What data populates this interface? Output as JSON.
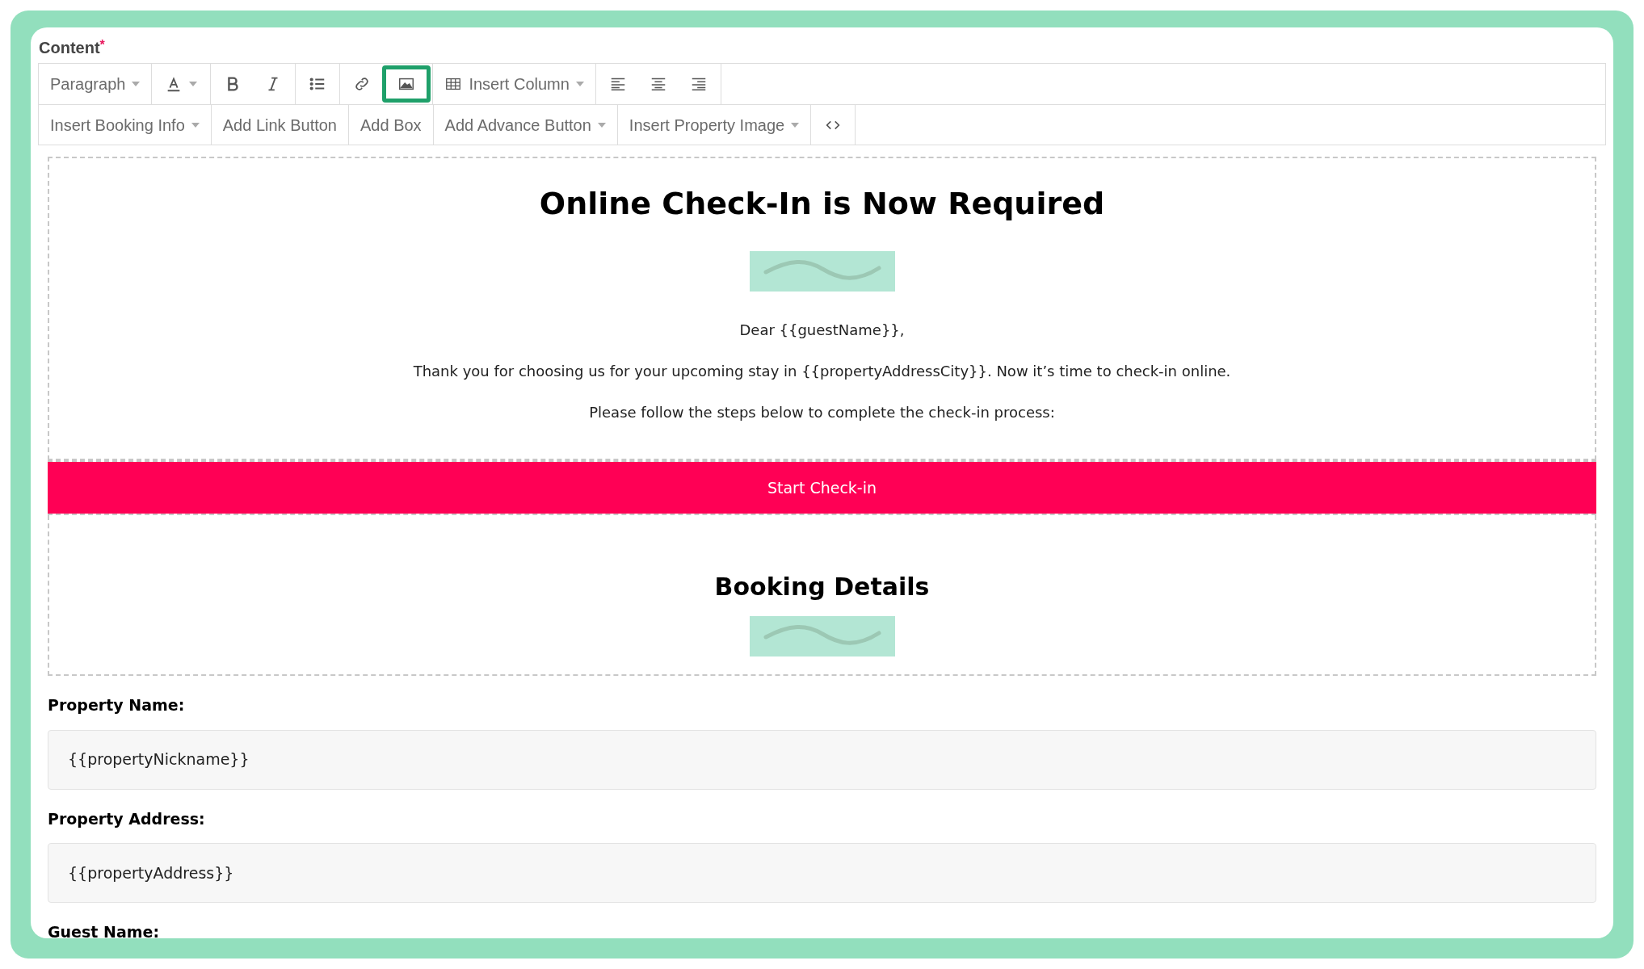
{
  "field_label": {
    "text": "Content",
    "required_mark": "*"
  },
  "toolbar_rows": [
    [
      [
        {
          "kind": "dropdown",
          "label": "Paragraph",
          "highlighted": false
        }
      ],
      [
        {
          "kind": "icon",
          "highlighted": false
        }
      ],
      [
        {
          "kind": "icon",
          "highlighted": false
        },
        {
          "kind": "icon",
          "highlighted": false
        }
      ],
      [
        {
          "kind": "icon",
          "highlighted": false
        }
      ],
      [
        {
          "kind": "icon",
          "highlighted": false
        },
        {
          "kind": "icon",
          "highlighted": true
        }
      ],
      [
        {
          "kind": "dropdown",
          "label": "Insert Column",
          "highlighted": false
        }
      ],
      [
        {
          "kind": "icon",
          "highlighted": false
        },
        {
          "kind": "icon",
          "highlighted": false
        },
        {
          "kind": "icon",
          "highlighted": false
        }
      ]
    ],
    [
      [
        {
          "kind": "dropdown",
          "label": "Insert Booking Info",
          "highlighted": false
        }
      ],
      [
        {
          "kind": "button",
          "label": "Add Link Button",
          "highlighted": false
        }
      ],
      [
        {
          "kind": "button",
          "label": "Add Box",
          "highlighted": false
        }
      ],
      [
        {
          "kind": "dropdown",
          "label": "Add Advance Button",
          "highlighted": false
        }
      ],
      [
        {
          "kind": "dropdown",
          "label": "Insert Property Image",
          "highlighted": false
        }
      ],
      [
        {
          "kind": "icon",
          "highlighted": false
        }
      ]
    ]
  ],
  "editor": {
    "intro": {
      "title": "Online Check-In is Now Required",
      "paragraphs": [
        "Dear {{guestName}},",
        "Thank you for choosing us for your upcoming stay in {{propertyAddressCity}}. Now it’s time to check-in online.",
        "Please follow the steps below to complete the check-in process:"
      ]
    },
    "cta_button": "Start Check-in",
    "section_title": "Booking Details",
    "fields": [
      {
        "label": "Property Name:",
        "value": "{{propertyNickname}}"
      },
      {
        "label": "Property Address:",
        "value": "{{propertyAddress}}"
      },
      {
        "label": "Guest Name:"
      }
    ]
  }
}
